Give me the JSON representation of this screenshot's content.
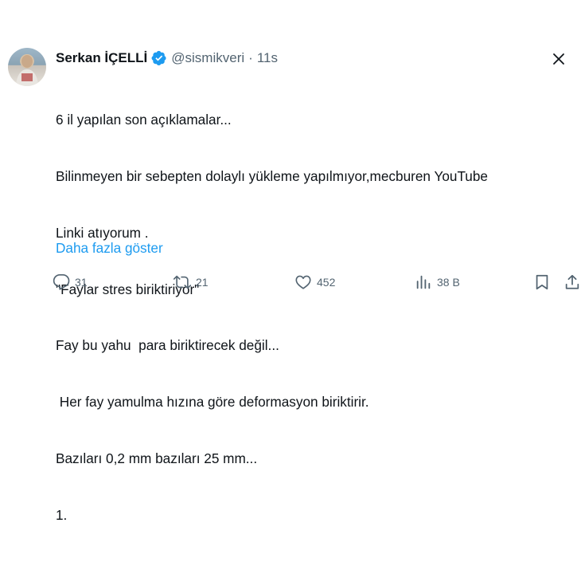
{
  "tweet": {
    "author_name": "Serkan İÇELLİ",
    "handle": "@sismikveri",
    "separator": "·",
    "time": "11s",
    "body_lines": [
      "6 il yapılan son açıklamalar...",
      "Bilinmeyen bir sebepten dolaylı yükleme yapılmıyor,mecburen YouTube",
      "Linki atıyorum .",
      "\"Faylar stres biriktiriyor\"",
      "Fay bu yahu  para biriktirecek değil...",
      " Her fay yamulma hızına göre deformasyon biriktirir.",
      "Bazıları 0,2 mm bazıları 25 mm...",
      "1."
    ],
    "show_more": "Daha fazla göster",
    "verified_color": "#1d9bf0"
  },
  "actions": {
    "reply": {
      "icon": "reply-icon",
      "count": "31"
    },
    "retweet": {
      "icon": "retweet-icon",
      "count": "21"
    },
    "like": {
      "icon": "heart-icon",
      "count": "452"
    },
    "views": {
      "icon": "views-icon",
      "count": "38 B"
    },
    "bookmark": {
      "icon": "bookmark-icon"
    },
    "share": {
      "icon": "share-icon"
    }
  }
}
